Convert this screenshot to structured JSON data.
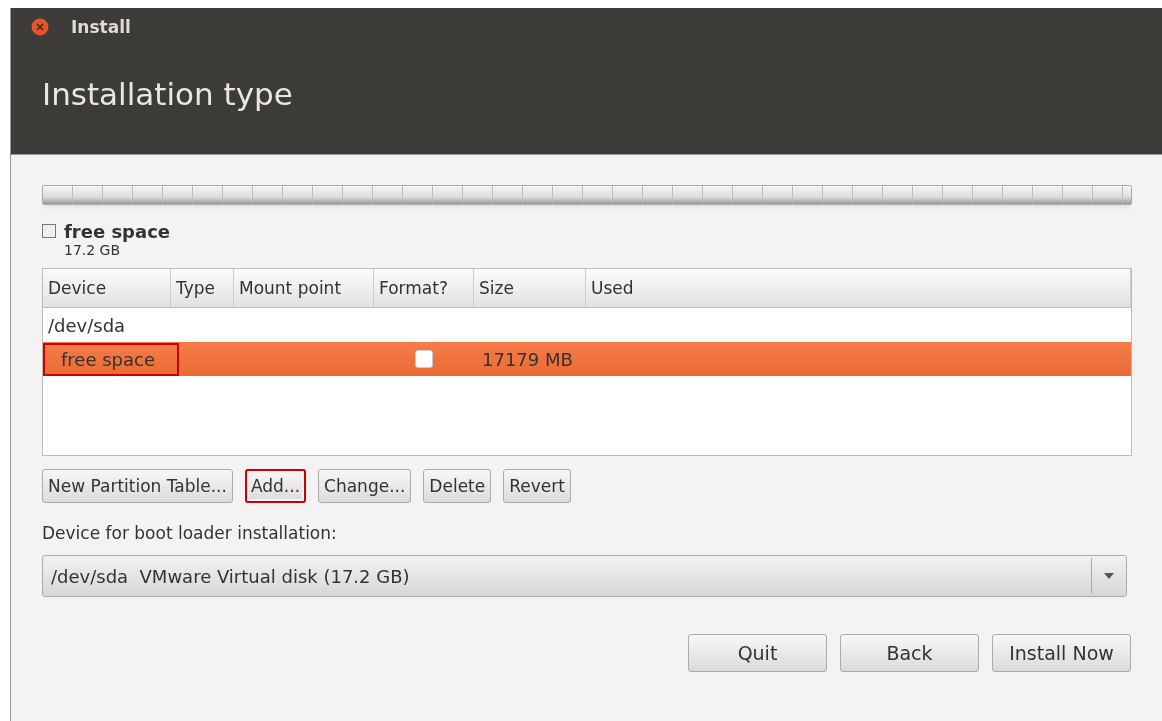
{
  "window": {
    "title": "Install"
  },
  "header": {
    "title": "Installation type"
  },
  "partition_legend": {
    "checked": false,
    "label": "free space",
    "size": "17.2 GB"
  },
  "table": {
    "columns": [
      "Device",
      "Type",
      "Mount point",
      "Format?",
      "Size",
      "Used"
    ],
    "rows": [
      {
        "kind": "disk",
        "device": "/dev/sda",
        "selected": false
      },
      {
        "kind": "partition",
        "device": "free space",
        "format": false,
        "size": "17179 MB",
        "selected": true,
        "highlighted": true
      }
    ]
  },
  "actions": [
    {
      "label": "New Partition Table...",
      "highlighted": false
    },
    {
      "label": "Add...",
      "highlighted": true
    },
    {
      "label": "Change...",
      "highlighted": false
    },
    {
      "label": "Delete",
      "highlighted": false
    },
    {
      "label": "Revert",
      "highlighted": false
    }
  ],
  "boot_loader": {
    "label": "Device for boot loader installation:",
    "value": "/dev/sda  VMware Virtual disk (17.2 GB)"
  },
  "buttons": [
    "Quit",
    "Back",
    "Install Now"
  ]
}
